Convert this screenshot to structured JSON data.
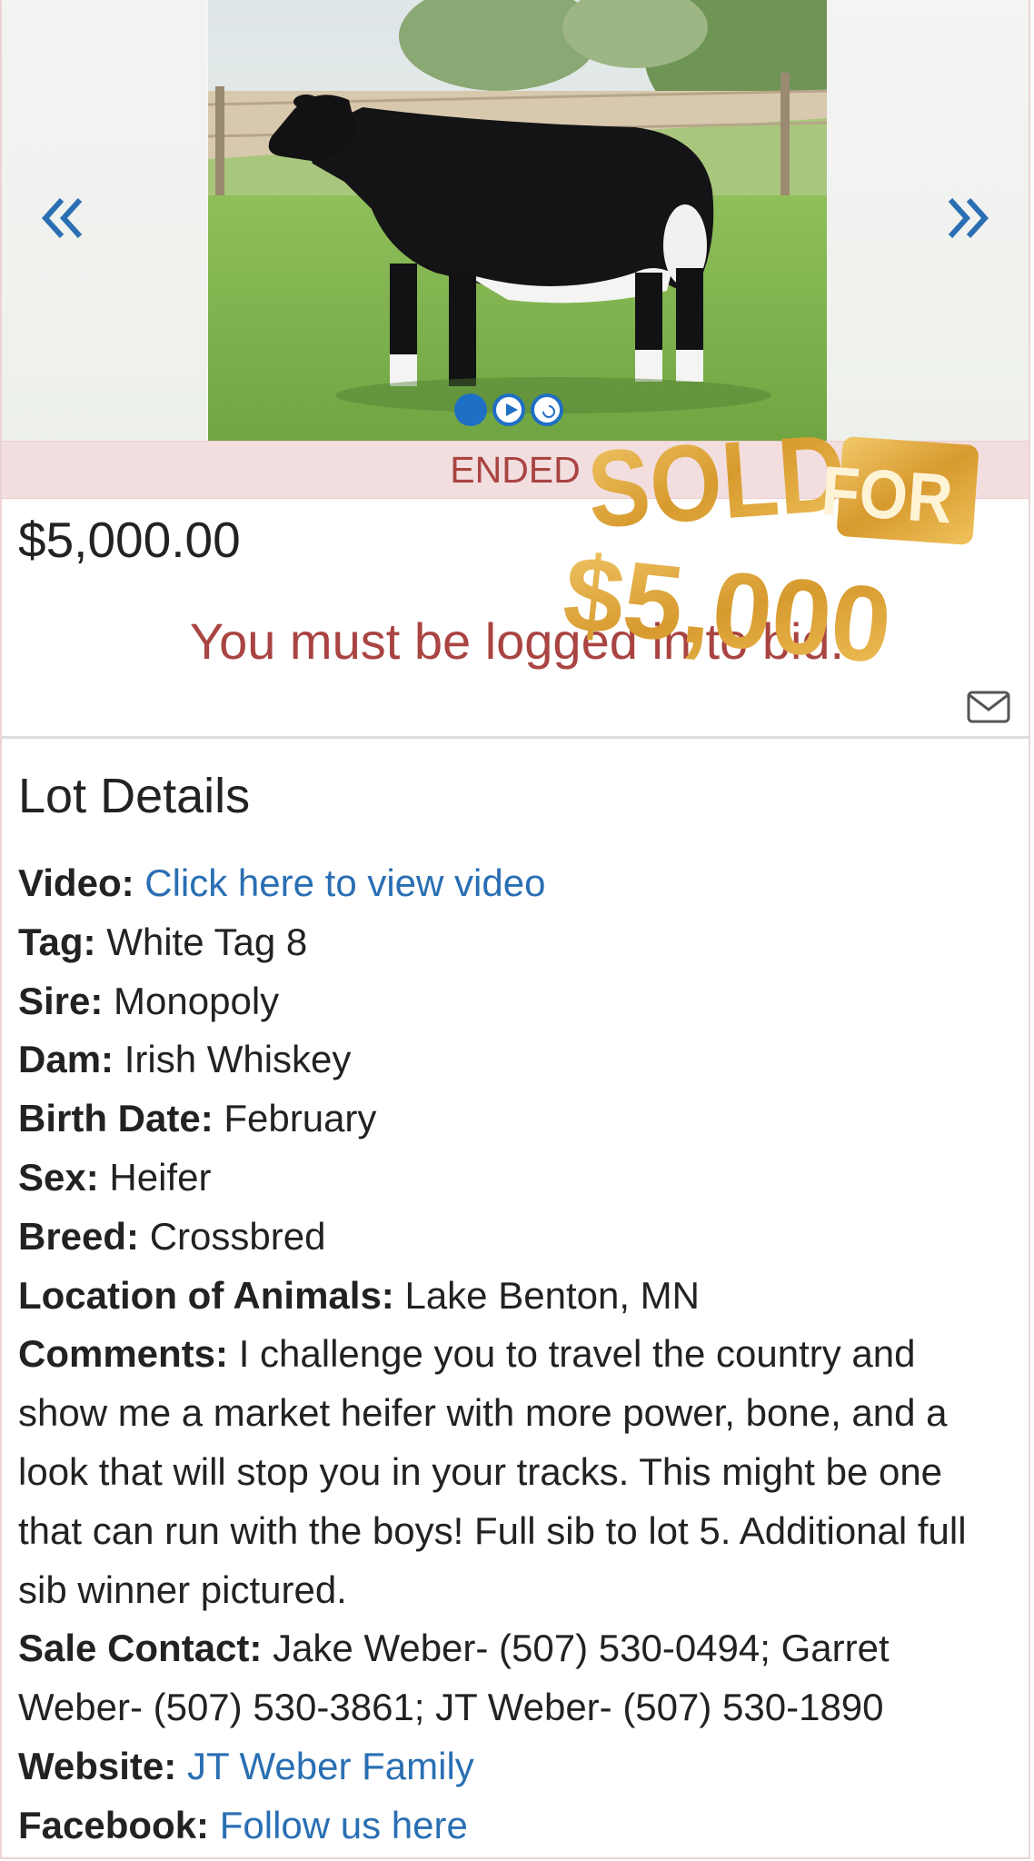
{
  "carousel": {
    "prev_icon": "double-chevron-left-icon",
    "next_icon": "double-chevron-right-icon",
    "indicators": [
      "image",
      "video",
      "image"
    ],
    "accent_color": "#1f6fc5"
  },
  "status": {
    "label": "ENDED",
    "color": "#a94442",
    "background": "#f2dede"
  },
  "price": "$5,000.00",
  "bid_message": "You must be logged in to bid.",
  "sold_stamp": {
    "line1": "SOLD",
    "line2": "FOR",
    "amount": "$5,000",
    "color": "#d9a43a"
  },
  "lot_details": {
    "title": "Lot Details",
    "video_label": "Video:",
    "video_link": "Click here to view video",
    "tag_label": "Tag:",
    "tag": "White Tag 8",
    "sire_label": "Sire:",
    "sire": "Monopoly",
    "dam_label": "Dam:",
    "dam": "Irish Whiskey",
    "birth_label": "Birth Date:",
    "birth_date": "February",
    "sex_label": "Sex:",
    "sex": "Heifer",
    "breed_label": "Breed:",
    "breed": "Crossbred",
    "location_label": "Location of Animals:",
    "location": "Lake Benton, MN",
    "comments_label": "Comments:",
    "comments": "I challenge you to travel the country and show me a market heifer with more power, bone, and a look that will stop you in your tracks. This might be one that can run with the boys! Full sib to lot 5. Additional full sib winner pictured.",
    "contact_label": "Sale Contact:",
    "contact": "Jake Weber- (507) 530-0494; Garret Weber- (507) 530-3861; JT Weber- (507) 530-1890",
    "website_label": "Website:",
    "website_link": "JT Weber Family",
    "facebook_label": "Facebook:",
    "facebook_link": "Follow us here",
    "link_color": "#2a6fb3"
  }
}
